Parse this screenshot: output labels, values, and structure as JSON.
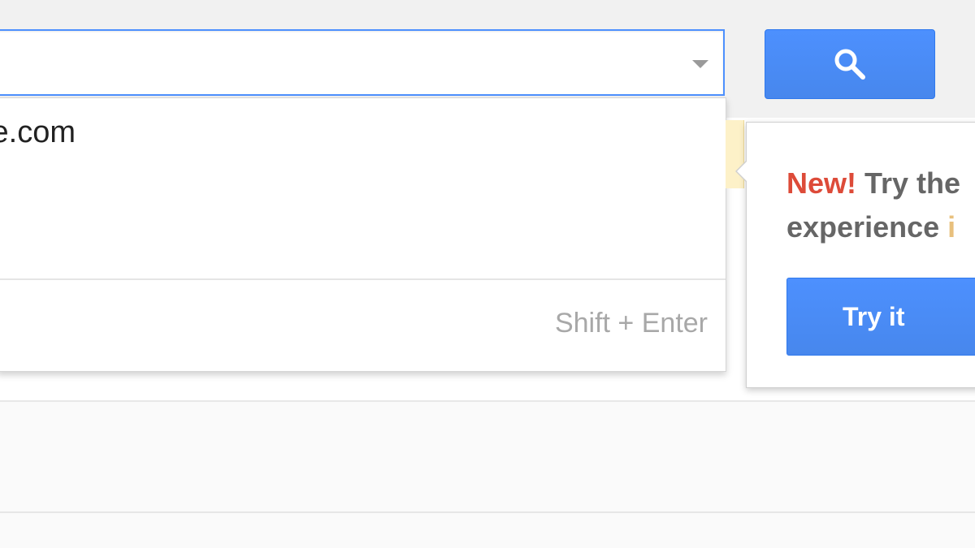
{
  "search": {
    "value": "",
    "button_label": "Search"
  },
  "suggestions": {
    "items": [
      {
        "text": "e.com"
      }
    ],
    "shortcut_hint": "Shift + Enter"
  },
  "promo": {
    "new_label": "New!",
    "line1_rest": " Try the",
    "line2": "experience",
    "line2_tail": " i",
    "button_label": "Try it"
  },
  "colors": {
    "accent_blue": "#4d90fe",
    "new_red": "#dd4b39",
    "hint_gray": "#a8a8a8"
  },
  "icons": {
    "search": "magnifier-icon",
    "dropdown": "triangle-down-icon"
  }
}
